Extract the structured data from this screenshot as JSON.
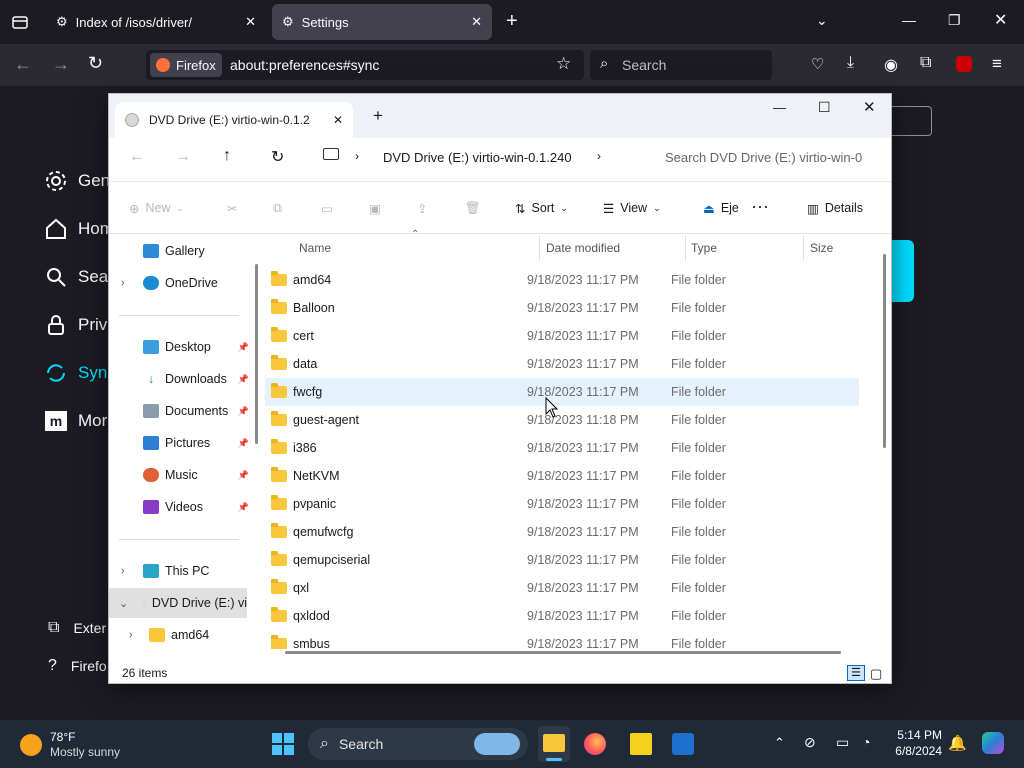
{
  "firefox": {
    "tabs": [
      {
        "label": "Index of /isos/driver/"
      },
      {
        "label": "Settings"
      }
    ],
    "url_label": "Firefox",
    "url": "about:preferences#sync",
    "search_placeholder": "Search",
    "prefs_nav": [
      "Gen",
      "Hom",
      "Sear",
      "Priva",
      "Sync",
      "Mor"
    ],
    "prefs_bottom": [
      "Exter",
      "Firefo"
    ]
  },
  "explorer": {
    "tab_title": "DVD Drive (E:) virtio-win-0.1.2",
    "breadcrumb": "DVD Drive (E:) virtio-win-0.1.240",
    "search_placeholder": "Search DVD Drive (E:) virtio-win-0",
    "toolbar": {
      "new_label": "New",
      "sort_label": "Sort",
      "view_label": "View",
      "eject_label": "Eje",
      "details_label": "Details"
    },
    "nav": [
      {
        "label": "Gallery"
      },
      {
        "label": "OneDrive"
      },
      {
        "label": "Desktop"
      },
      {
        "label": "Downloads"
      },
      {
        "label": "Documents"
      },
      {
        "label": "Pictures"
      },
      {
        "label": "Music"
      },
      {
        "label": "Videos"
      },
      {
        "label": "This PC"
      },
      {
        "label": "DVD Drive (E:) vi"
      },
      {
        "label": "amd64"
      }
    ],
    "columns": {
      "name": "Name",
      "date": "Date modified",
      "type": "Type",
      "size": "Size"
    },
    "rows": [
      {
        "name": "amd64",
        "date": "9/18/2023 11:17 PM",
        "type": "File folder"
      },
      {
        "name": "Balloon",
        "date": "9/18/2023 11:17 PM",
        "type": "File folder"
      },
      {
        "name": "cert",
        "date": "9/18/2023 11:17 PM",
        "type": "File folder"
      },
      {
        "name": "data",
        "date": "9/18/2023 11:17 PM",
        "type": "File folder"
      },
      {
        "name": "fwcfg",
        "date": "9/18/2023 11:17 PM",
        "type": "File folder"
      },
      {
        "name": "guest-agent",
        "date": "9/18/2023 11:18 PM",
        "type": "File folder"
      },
      {
        "name": "i386",
        "date": "9/18/2023 11:17 PM",
        "type": "File folder"
      },
      {
        "name": "NetKVM",
        "date": "9/18/2023 11:17 PM",
        "type": "File folder"
      },
      {
        "name": "pvpanic",
        "date": "9/18/2023 11:17 PM",
        "type": "File folder"
      },
      {
        "name": "qemufwcfg",
        "date": "9/18/2023 11:17 PM",
        "type": "File folder"
      },
      {
        "name": "qemupciserial",
        "date": "9/18/2023 11:17 PM",
        "type": "File folder"
      },
      {
        "name": "qxl",
        "date": "9/18/2023 11:17 PM",
        "type": "File folder"
      },
      {
        "name": "qxldod",
        "date": "9/18/2023 11:17 PM",
        "type": "File folder"
      },
      {
        "name": "smbus",
        "date": "9/18/2023 11:17 PM",
        "type": "File folder"
      }
    ],
    "status": "26 items"
  },
  "taskbar": {
    "weather_temp": "78°F",
    "weather_desc": "Mostly sunny",
    "search_placeholder": "Search",
    "time": "5:14 PM",
    "date": "6/8/2024"
  },
  "colors": {
    "accent": "#00ddff",
    "selection": "#e5f1fb",
    "folder": "#f8c73c"
  }
}
